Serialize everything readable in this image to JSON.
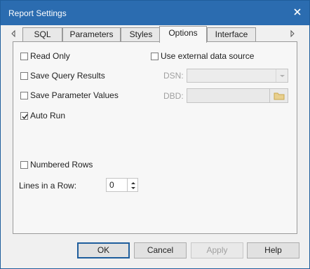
{
  "window": {
    "title": "Report Settings"
  },
  "tabs": [
    {
      "label": "SQL",
      "active": false
    },
    {
      "label": "Parameters",
      "active": false
    },
    {
      "label": "Styles",
      "active": false
    },
    {
      "label": "Options",
      "active": true
    },
    {
      "label": "Interface",
      "active": false
    }
  ],
  "options": {
    "read_only": {
      "label": "Read Only",
      "checked": false
    },
    "save_query_results": {
      "label": "Save Query Results",
      "checked": false
    },
    "save_parameter_values": {
      "label": "Save Parameter Values",
      "checked": false
    },
    "auto_run": {
      "label": "Auto Run",
      "checked": true
    },
    "use_external_data_source": {
      "label": "Use external data source",
      "checked": false
    },
    "numbered_rows": {
      "label": "Numbered Rows",
      "checked": false
    },
    "dsn_label": "DSN:",
    "dsn_value": "",
    "dbd_label": "DBD:",
    "dbd_value": "",
    "lines_in_row_label": "Lines in a Row:",
    "lines_in_row_value": "0"
  },
  "buttons": {
    "ok": "OK",
    "cancel": "Cancel",
    "apply": "Apply",
    "help": "Help"
  },
  "icons": {
    "close": "close-icon",
    "scroll_left": "triangle-left-icon",
    "scroll_right": "triangle-right-icon",
    "checkmark": "checkmark-icon",
    "dropdown": "chevron-down-icon",
    "folder": "folder-icon",
    "spin_up": "triangle-up-icon",
    "spin_down": "triangle-down-icon"
  },
  "colors": {
    "titlebar": "#2b6cb0",
    "default_button_border": "#1f5e9c"
  }
}
